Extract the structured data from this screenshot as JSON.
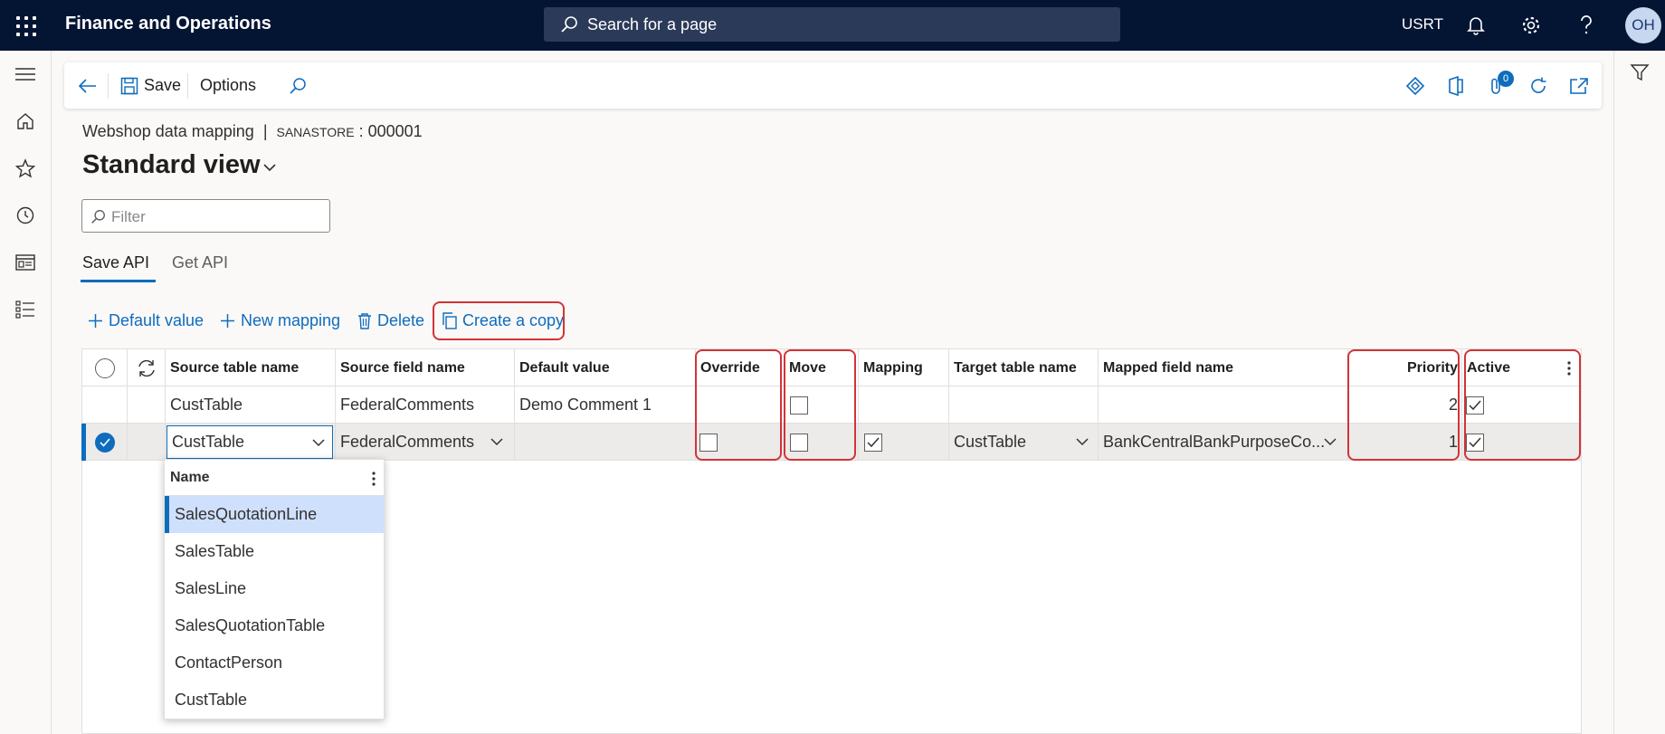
{
  "topbar": {
    "app_title": "Finance and Operations",
    "search_placeholder": "Search for a page",
    "company": "USRT",
    "avatar_initials": "OH"
  },
  "actionpane": {
    "save_label": "Save",
    "options_label": "Options",
    "notification_count": "0"
  },
  "header": {
    "page_name": "Webshop data mapping",
    "separator": "|",
    "record_prefix": "SANASTORE",
    "record_value": ": 000001",
    "view_title": "Standard view"
  },
  "filter": {
    "placeholder": "Filter"
  },
  "tabs": [
    {
      "label": "Save API",
      "active": true
    },
    {
      "label": "Get API",
      "active": false
    }
  ],
  "grid_toolbar": {
    "default_value": "Default value",
    "new_mapping": "New mapping",
    "delete": "Delete",
    "create_copy": "Create a copy"
  },
  "grid": {
    "columns": {
      "source_table": "Source table name",
      "source_field": "Source field name",
      "default_value": "Default value",
      "override": "Override",
      "move": "Move",
      "mapping": "Mapping",
      "target_table": "Target table name",
      "mapped_field": "Mapped field name",
      "priority": "Priority",
      "active": "Active"
    },
    "rows": [
      {
        "source_table": "CustTable",
        "source_field": "FederalComments",
        "default_value": "Demo Comment 1",
        "override": null,
        "move": false,
        "mapping": null,
        "target_table": "",
        "mapped_field": "",
        "priority": "2",
        "active": true,
        "selected": false
      },
      {
        "source_table": "CustTable",
        "source_field": "FederalComments",
        "default_value": "",
        "override": false,
        "move": false,
        "mapping": true,
        "target_table": "CustTable",
        "mapped_field": "BankCentralBankPurposeCo...",
        "priority": "1",
        "active": true,
        "selected": true
      }
    ]
  },
  "lookup": {
    "header": "Name",
    "items": [
      "SalesQuotationLine",
      "SalesTable",
      "SalesLine",
      "SalesQuotationTable",
      "ContactPerson",
      "CustTable"
    ],
    "highlighted": "SalesQuotationLine"
  },
  "colors": {
    "topbar_bg": "#041534",
    "accent": "#0f6cbd",
    "highlight_outline": "#d13438"
  }
}
